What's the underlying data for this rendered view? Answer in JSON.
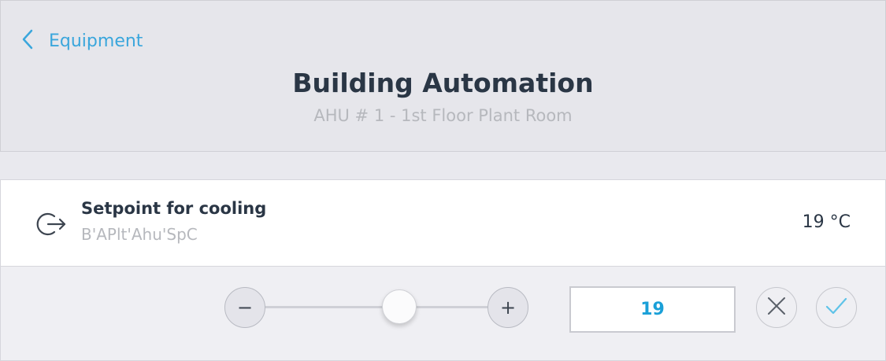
{
  "header": {
    "back_label": "Equipment",
    "title": "Building Automation",
    "subtitle": "AHU # 1 - 1st Floor Plant Room"
  },
  "datapoint": {
    "icon": "output-arrow-icon",
    "name": "Setpoint for cooling",
    "address": "B'APlt'Ahu'SpC",
    "value_display": "19 °C"
  },
  "editor": {
    "minus_label": "−",
    "plus_label": "+",
    "value": "19",
    "slider_fraction": 0.6
  },
  "colors": {
    "accent": "#3aa6dc",
    "value_text": "#1aa0d8",
    "title_text": "#2a3645",
    "muted_text": "#b6b8bd"
  }
}
